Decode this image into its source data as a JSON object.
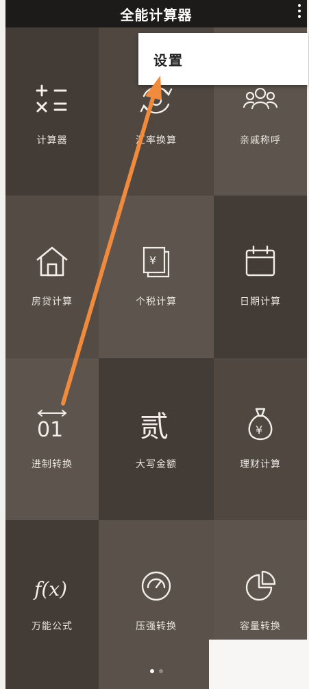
{
  "app": {
    "title": "全能计算器"
  },
  "menu": {
    "settings_label": "设置"
  },
  "tiles": [
    {
      "label": "计算器",
      "icon": "calculator-icon"
    },
    {
      "label": "汇率换算",
      "icon": "exchange-icon"
    },
    {
      "label": "亲戚称呼",
      "icon": "relatives-icon"
    },
    {
      "label": "房贷计算",
      "icon": "house-icon"
    },
    {
      "label": "个税计算",
      "icon": "tax-doc-icon"
    },
    {
      "label": "日期计算",
      "icon": "calendar-icon"
    },
    {
      "label": "进制转换",
      "icon": "binary-icon"
    },
    {
      "label": "大写金额",
      "icon": "uppercase-number-icon"
    },
    {
      "label": "理财计算",
      "icon": "money-bag-icon"
    },
    {
      "label": "万能公式",
      "icon": "formula-icon"
    },
    {
      "label": "压强转换",
      "icon": "gauge-icon"
    },
    {
      "label": "容量转换",
      "icon": "pie-chart-icon"
    }
  ],
  "icon_text": {
    "binary": "01",
    "uppercase": "贰",
    "yen": "¥",
    "formula": "f(x)"
  },
  "colors": {
    "accent_arrow": "#f08a3c",
    "appbar": "#1d1b1a",
    "tile_text": "#e9e4dd"
  }
}
